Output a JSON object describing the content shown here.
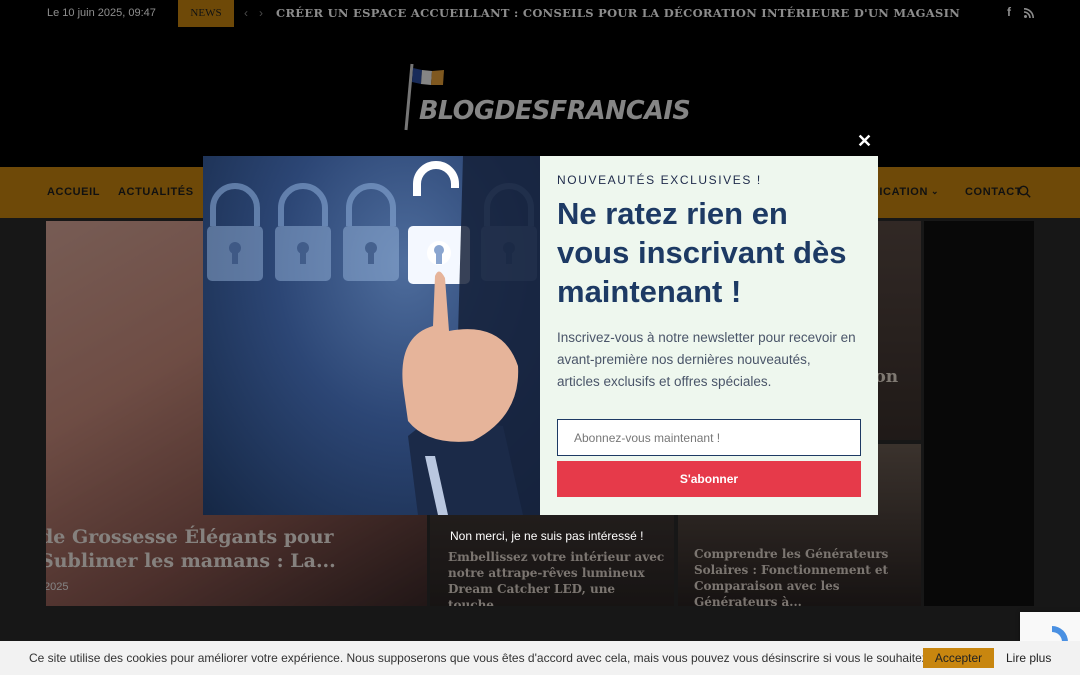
{
  "topbar": {
    "date": "Le 10 juin 2025, 09:47",
    "news_label": "NEWS",
    "ticker_headline": "CRÉER UN ESPACE ACCUEILLANT : CONSEILS POUR LA DÉCORATION INTÉRIEURE D'UN MAGASIN",
    "prev_icon": "chevron-left-icon",
    "next_icon": "chevron-right-icon",
    "social_icons": [
      "facebook-icon",
      "rss-icon"
    ]
  },
  "header": {
    "logo_text": "BLOGDESFRANCAIS",
    "logo_icon": "french-flag-icon"
  },
  "nav": {
    "items": [
      "ACCUEIL",
      "ACTUALITÉS",
      "COMMUNICATION",
      "CONTACT"
    ],
    "search_icon": "search-icon"
  },
  "content": {
    "big_card": {
      "title": "de Grossesse Élégants pour Sublimer les mamans : La...",
      "date": "2025"
    },
    "mid_card": {
      "title": "Embellissez votre intérieur avec notre attrape-rêves lumineux Dream Catcher LED, une touche..."
    },
    "right_top_card": {
      "title": "ion"
    },
    "right_bottom_card": {
      "title": "Comprendre les Générateurs Solaires : Fonctionnement et Comparaison avec les Générateurs à..."
    }
  },
  "modal": {
    "eyebrow": "NOUVEAUTÉS EXCLUSIVES !",
    "headline": "Ne ratez rien en vous inscrivant dès maintenant !",
    "description": "Inscrivez-vous à notre newsletter pour recevoir en avant-première nos dernières nouveautés, articles exclusifs et offres spéciales.",
    "input_placeholder": "Abonnez-vous maintenant !",
    "button_label": "S'abonner",
    "decline_label": "Non merci, je ne suis pas intéressé !",
    "close_label": "✕"
  },
  "cookie": {
    "text": "Ce site utilise des cookies pour améliorer votre expérience. Nous supposerons que vous êtes d'accord avec cela, mais vous pouvez vous désinscrire si vous le souhaitez.",
    "accept_label": "Accepter",
    "more_label": "Lire plus"
  },
  "colors": {
    "accent": "#c8860f",
    "header_bg": "#000000",
    "modal_bg": "#eef7ee",
    "headline": "#1d3a64",
    "subscribe": "#e63a4a"
  }
}
